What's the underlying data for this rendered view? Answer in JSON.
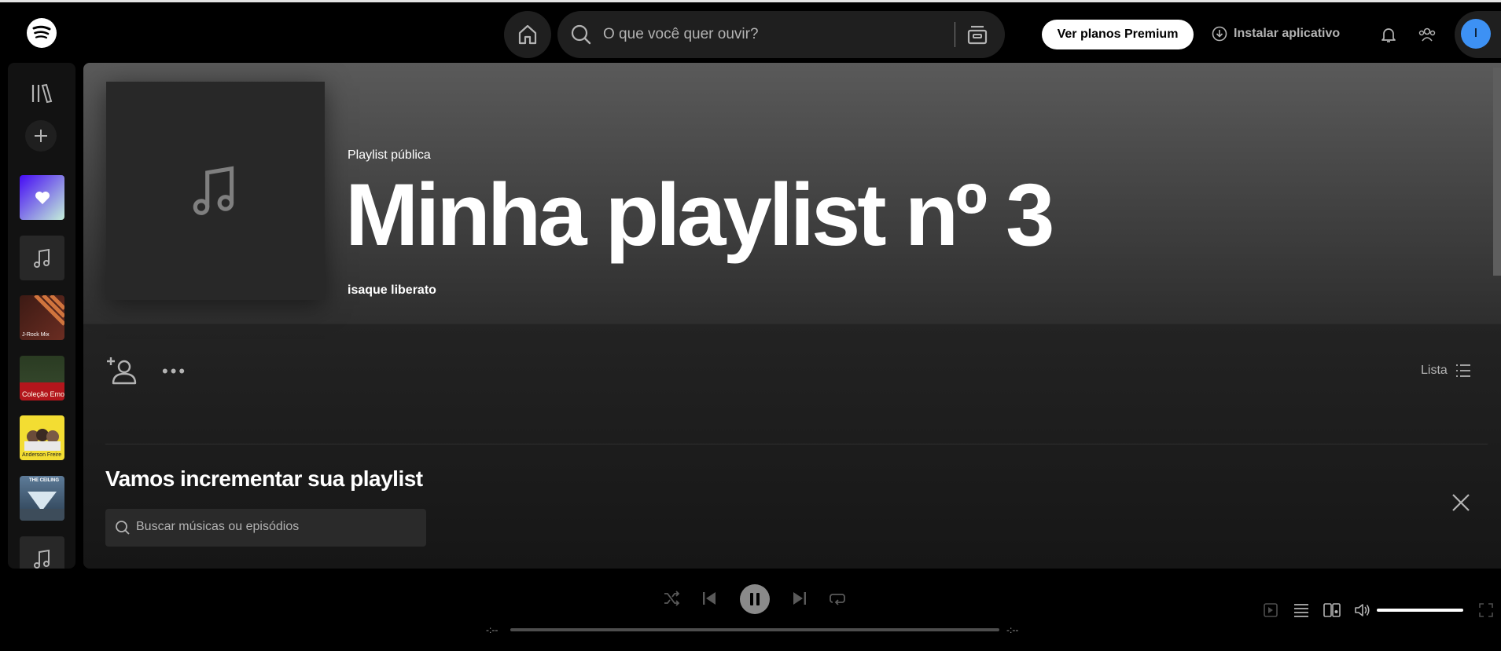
{
  "topbar": {
    "search_placeholder": "O que você quer ouvir?",
    "premium_label": "Ver planos Premium",
    "install_label": "Instalar aplicativo",
    "avatar_initial": "I"
  },
  "sidebar": {
    "items": [
      {
        "name": "Músicas Curtidas",
        "icon": "heart-icon"
      },
      {
        "name": "Playlist",
        "icon": "music-note-icon"
      },
      {
        "name": "J-Rock Mix",
        "caption": "J-Rock Mix"
      },
      {
        "name": "Coleção Emo",
        "caption": "Coleção Emo"
      },
      {
        "name": "Anderson Freire",
        "caption": "Anderson Freire"
      },
      {
        "name": "The Ceiling",
        "caption": "THE CEILING"
      },
      {
        "name": "Playlist",
        "icon": "music-note-icon"
      }
    ]
  },
  "playlist": {
    "type_label": "Playlist pública",
    "title": "Minha playlist nº 3",
    "owner": "isaque liberato"
  },
  "actions": {
    "view_label": "Lista"
  },
  "recommend": {
    "title": "Vamos incrementar sua playlist",
    "search_placeholder": "Buscar músicas ou episódios"
  },
  "player": {
    "elapsed": "-:--",
    "remaining": "-:--",
    "volume": 1.0,
    "progress": 0.0
  },
  "colors": {
    "accent": "#3d91f4",
    "background": "#000000",
    "surface": "#121212"
  }
}
